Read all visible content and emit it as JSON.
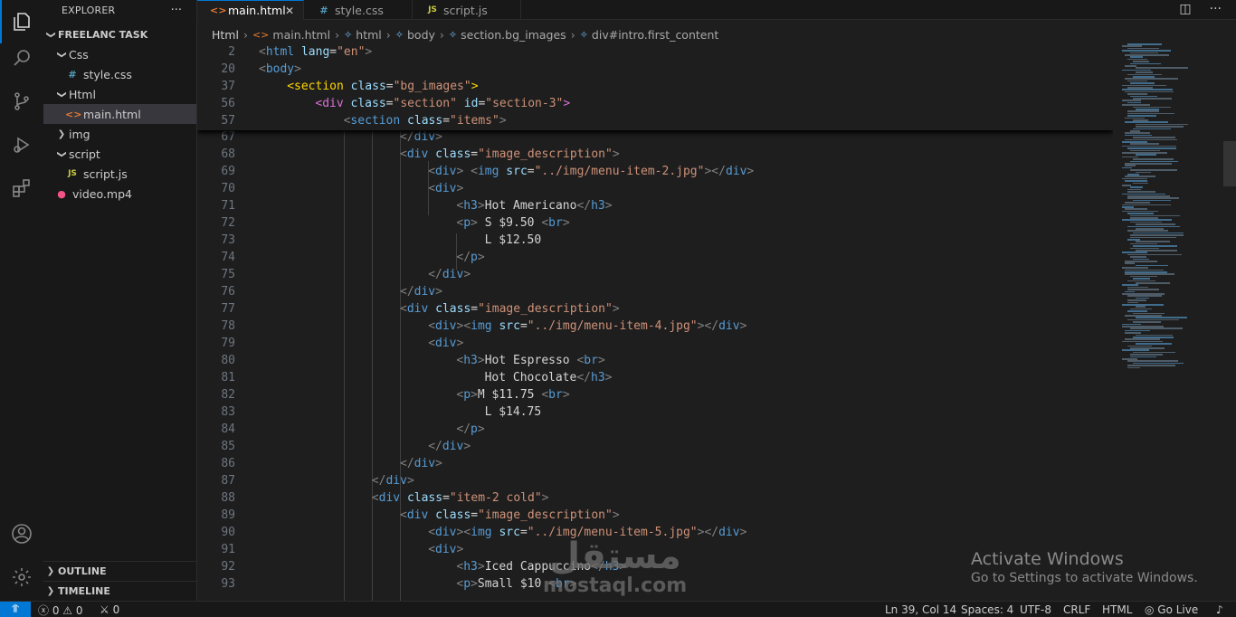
{
  "explorer": {
    "title": "EXPLORER",
    "more": "···",
    "project": "FREELANC TASK",
    "items": [
      {
        "label": "Css",
        "chevron": "❯",
        "expanded": true
      },
      {
        "label": "style.css",
        "icon": "#",
        "icon_color": "#519aba"
      },
      {
        "label": "Html",
        "chevron": "❯",
        "expanded": true
      },
      {
        "label": "main.html",
        "icon": "<>",
        "icon_color": "#e37933",
        "selected": true
      },
      {
        "label": "img",
        "chevron": "❯",
        "expanded": false
      },
      {
        "label": "script",
        "chevron": "❯",
        "expanded": true
      },
      {
        "label": "script.js",
        "icon": "JS",
        "icon_color": "#cbcb41"
      },
      {
        "label": "video.mp4",
        "icon": "●",
        "icon_color": "#f55385"
      }
    ],
    "outline": "OUTLINE",
    "timeline": "TIMELINE"
  },
  "tabs": [
    {
      "label": "main.html",
      "icon": "<>",
      "icon_color": "#e37933",
      "active": true,
      "close": "✕"
    },
    {
      "label": "style.css",
      "icon": "#",
      "icon_color": "#519aba"
    },
    {
      "label": "script.js",
      "icon": "JS",
      "icon_color": "#cbcb41"
    }
  ],
  "breadcrumb": [
    "Html",
    "main.html",
    "html",
    "body",
    "section.bg_images",
    "div#intro.first_content"
  ],
  "sticky_lines": [
    {
      "n": "2",
      "indent": 0,
      "tokens": [
        [
          "br",
          "<"
        ],
        [
          "tag",
          "html"
        ],
        [
          "txt",
          " "
        ],
        [
          "attr",
          "lang"
        ],
        [
          "txt",
          "="
        ],
        [
          "str",
          "\"en\""
        ],
        [
          "br",
          ">"
        ]
      ]
    },
    {
      "n": "20",
      "indent": 0,
      "tokens": [
        [
          "br",
          "<"
        ],
        [
          "tag",
          "body"
        ],
        [
          "br",
          ">"
        ]
      ]
    },
    {
      "n": "37",
      "indent": 1,
      "tokens": [
        [
          "hl",
          "<"
        ],
        [
          "hl",
          "section"
        ],
        [
          "txt",
          " "
        ],
        [
          "attr",
          "class"
        ],
        [
          "txt",
          "="
        ],
        [
          "str",
          "\"bg_images\""
        ],
        [
          "hl",
          ">"
        ]
      ]
    },
    {
      "n": "56",
      "indent": 2,
      "tokens": [
        [
          "or",
          "<"
        ],
        [
          "or",
          "div"
        ],
        [
          "txt",
          " "
        ],
        [
          "attr",
          "class"
        ],
        [
          "txt",
          "="
        ],
        [
          "str",
          "\"section\""
        ],
        [
          "txt",
          " "
        ],
        [
          "attr",
          "id"
        ],
        [
          "txt",
          "="
        ],
        [
          "str",
          "\"section-3\""
        ],
        [
          "or",
          ">"
        ]
      ]
    },
    {
      "n": "57",
      "indent": 3,
      "tokens": [
        [
          "br",
          "<"
        ],
        [
          "tag",
          "section"
        ],
        [
          "txt",
          " "
        ],
        [
          "attr",
          "class"
        ],
        [
          "txt",
          "="
        ],
        [
          "str",
          "\"items\""
        ],
        [
          "br",
          ">"
        ]
      ]
    }
  ],
  "code_lines": [
    {
      "n": "67",
      "indent": 5,
      "tokens": [
        [
          "br",
          "</"
        ],
        [
          "tag",
          "div"
        ],
        [
          "br",
          ">"
        ]
      ]
    },
    {
      "n": "68",
      "indent": 5,
      "tokens": [
        [
          "br",
          "<"
        ],
        [
          "tag",
          "div"
        ],
        [
          "txt",
          " "
        ],
        [
          "attr",
          "class"
        ],
        [
          "txt",
          "="
        ],
        [
          "str",
          "\"image_description\""
        ],
        [
          "br",
          ">"
        ]
      ]
    },
    {
      "n": "69",
      "indent": 6,
      "tokens": [
        [
          "br",
          "<"
        ],
        [
          "tag",
          "div"
        ],
        [
          "br",
          ">"
        ],
        [
          "txt",
          " "
        ],
        [
          "br",
          "<"
        ],
        [
          "tag",
          "img"
        ],
        [
          "txt",
          " "
        ],
        [
          "attr",
          "src"
        ],
        [
          "txt",
          "="
        ],
        [
          "str",
          "\"../img/menu-item-2.jpg\""
        ],
        [
          "br",
          ">"
        ],
        [
          "br",
          "</"
        ],
        [
          "tag",
          "div"
        ],
        [
          "br",
          ">"
        ]
      ]
    },
    {
      "n": "70",
      "indent": 6,
      "tokens": [
        [
          "br",
          "<"
        ],
        [
          "tag",
          "div"
        ],
        [
          "br",
          ">"
        ]
      ]
    },
    {
      "n": "71",
      "indent": 7,
      "tokens": [
        [
          "br",
          "<"
        ],
        [
          "tag",
          "h3"
        ],
        [
          "br",
          ">"
        ],
        [
          "txt",
          "Hot Americano"
        ],
        [
          "br",
          "</"
        ],
        [
          "tag",
          "h3"
        ],
        [
          "br",
          ">"
        ]
      ]
    },
    {
      "n": "72",
      "indent": 7,
      "tokens": [
        [
          "br",
          "<"
        ],
        [
          "tag",
          "p"
        ],
        [
          "br",
          ">"
        ],
        [
          "txt",
          " S $9.50 "
        ],
        [
          "br",
          "<"
        ],
        [
          "tag",
          "br"
        ],
        [
          "br",
          ">"
        ]
      ]
    },
    {
      "n": "73",
      "indent": 8,
      "tokens": [
        [
          "txt",
          "L $12.50"
        ]
      ]
    },
    {
      "n": "74",
      "indent": 7,
      "tokens": [
        [
          "br",
          "</"
        ],
        [
          "tag",
          "p"
        ],
        [
          "br",
          ">"
        ]
      ]
    },
    {
      "n": "75",
      "indent": 6,
      "tokens": [
        [
          "br",
          "</"
        ],
        [
          "tag",
          "div"
        ],
        [
          "br",
          ">"
        ]
      ]
    },
    {
      "n": "76",
      "indent": 5,
      "tokens": [
        [
          "br",
          "</"
        ],
        [
          "tag",
          "div"
        ],
        [
          "br",
          ">"
        ]
      ]
    },
    {
      "n": "77",
      "indent": 5,
      "tokens": [
        [
          "br",
          "<"
        ],
        [
          "tag",
          "div"
        ],
        [
          "txt",
          " "
        ],
        [
          "attr",
          "class"
        ],
        [
          "txt",
          "="
        ],
        [
          "str",
          "\"image_description\""
        ],
        [
          "br",
          ">"
        ]
      ]
    },
    {
      "n": "78",
      "indent": 6,
      "tokens": [
        [
          "br",
          "<"
        ],
        [
          "tag",
          "div"
        ],
        [
          "br",
          ">"
        ],
        [
          "br",
          "<"
        ],
        [
          "tag",
          "img"
        ],
        [
          "txt",
          " "
        ],
        [
          "attr",
          "src"
        ],
        [
          "txt",
          "="
        ],
        [
          "str",
          "\"../img/menu-item-4.jpg\""
        ],
        [
          "br",
          ">"
        ],
        [
          "br",
          "</"
        ],
        [
          "tag",
          "div"
        ],
        [
          "br",
          ">"
        ]
      ]
    },
    {
      "n": "79",
      "indent": 6,
      "tokens": [
        [
          "br",
          "<"
        ],
        [
          "tag",
          "div"
        ],
        [
          "br",
          ">"
        ]
      ]
    },
    {
      "n": "80",
      "indent": 7,
      "tokens": [
        [
          "br",
          "<"
        ],
        [
          "tag",
          "h3"
        ],
        [
          "br",
          ">"
        ],
        [
          "txt",
          "Hot Espresso "
        ],
        [
          "br",
          "<"
        ],
        [
          "tag",
          "br"
        ],
        [
          "br",
          ">"
        ]
      ]
    },
    {
      "n": "81",
      "indent": 8,
      "tokens": [
        [
          "txt",
          "Hot Chocolate"
        ],
        [
          "br",
          "</"
        ],
        [
          "tag",
          "h3"
        ],
        [
          "br",
          ">"
        ]
      ]
    },
    {
      "n": "82",
      "indent": 7,
      "tokens": [
        [
          "br",
          "<"
        ],
        [
          "tag",
          "p"
        ],
        [
          "br",
          ">"
        ],
        [
          "txt",
          "M $11.75 "
        ],
        [
          "br",
          "<"
        ],
        [
          "tag",
          "br"
        ],
        [
          "br",
          ">"
        ]
      ]
    },
    {
      "n": "83",
      "indent": 8,
      "tokens": [
        [
          "txt",
          "L $14.75"
        ]
      ]
    },
    {
      "n": "84",
      "indent": 7,
      "tokens": [
        [
          "br",
          "</"
        ],
        [
          "tag",
          "p"
        ],
        [
          "br",
          ">"
        ]
      ]
    },
    {
      "n": "85",
      "indent": 6,
      "tokens": [
        [
          "br",
          "</"
        ],
        [
          "tag",
          "div"
        ],
        [
          "br",
          ">"
        ]
      ]
    },
    {
      "n": "86",
      "indent": 5,
      "tokens": [
        [
          "br",
          "</"
        ],
        [
          "tag",
          "div"
        ],
        [
          "br",
          ">"
        ]
      ]
    },
    {
      "n": "87",
      "indent": 4,
      "tokens": [
        [
          "br",
          "</"
        ],
        [
          "tag",
          "div"
        ],
        [
          "br",
          ">"
        ]
      ]
    },
    {
      "n": "88",
      "indent": 4,
      "tokens": [
        [
          "br",
          "<"
        ],
        [
          "tag",
          "div"
        ],
        [
          "txt",
          " "
        ],
        [
          "attr",
          "class"
        ],
        [
          "txt",
          "="
        ],
        [
          "str",
          "\"item-2 cold\""
        ],
        [
          "br",
          ">"
        ]
      ]
    },
    {
      "n": "89",
      "indent": 5,
      "tokens": [
        [
          "br",
          "<"
        ],
        [
          "tag",
          "div"
        ],
        [
          "txt",
          " "
        ],
        [
          "attr",
          "class"
        ],
        [
          "txt",
          "="
        ],
        [
          "str",
          "\"image_description\""
        ],
        [
          "br",
          ">"
        ]
      ]
    },
    {
      "n": "90",
      "indent": 6,
      "tokens": [
        [
          "br",
          "<"
        ],
        [
          "tag",
          "div"
        ],
        [
          "br",
          ">"
        ],
        [
          "br",
          "<"
        ],
        [
          "tag",
          "img"
        ],
        [
          "txt",
          " "
        ],
        [
          "attr",
          "src"
        ],
        [
          "txt",
          "="
        ],
        [
          "str",
          "\"../img/menu-item-5.jpg\""
        ],
        [
          "br",
          ">"
        ],
        [
          "br",
          "</"
        ],
        [
          "tag",
          "div"
        ],
        [
          "br",
          ">"
        ]
      ]
    },
    {
      "n": "91",
      "indent": 6,
      "tokens": [
        [
          "br",
          "<"
        ],
        [
          "tag",
          "div"
        ],
        [
          "br",
          ">"
        ]
      ]
    },
    {
      "n": "92",
      "indent": 7,
      "tokens": [
        [
          "br",
          "<"
        ],
        [
          "tag",
          "h3"
        ],
        [
          "br",
          ">"
        ],
        [
          "txt",
          "Iced Cappuccino"
        ],
        [
          "br",
          "</"
        ],
        [
          "tag",
          "h3"
        ],
        [
          "br",
          ">"
        ]
      ]
    },
    {
      "n": "93",
      "indent": 7,
      "tokens": [
        [
          "br",
          "<"
        ],
        [
          "tag",
          "p"
        ],
        [
          "br",
          ">"
        ],
        [
          "txt",
          "Small $10 "
        ],
        [
          "br",
          "<"
        ],
        [
          "tag",
          "br"
        ],
        [
          "br",
          ">"
        ]
      ]
    }
  ],
  "watermark": {
    "activate_title": "Activate Windows",
    "activate_sub": "Go to Settings to activate Windows.",
    "brand_ar": "مستقل",
    "brand_en": "mostaql.com"
  },
  "status": {
    "remote_icon": "⥣",
    "problems": "ⓧ 0 ⚠ 0",
    "ports": "⚔ 0",
    "position": "Ln 39, Col 14",
    "spaces": "Spaces: 4",
    "encoding": "UTF-8",
    "eol": "CRLF",
    "language": "HTML",
    "golive": "◎ Go Live",
    "bell": "♪"
  },
  "colors": {
    "accent": "#0078d4",
    "tag": "#569cd6",
    "attr": "#9cdcfe",
    "string": "#ce9178",
    "text": "#d4d4d4",
    "bracket": "#808080"
  }
}
